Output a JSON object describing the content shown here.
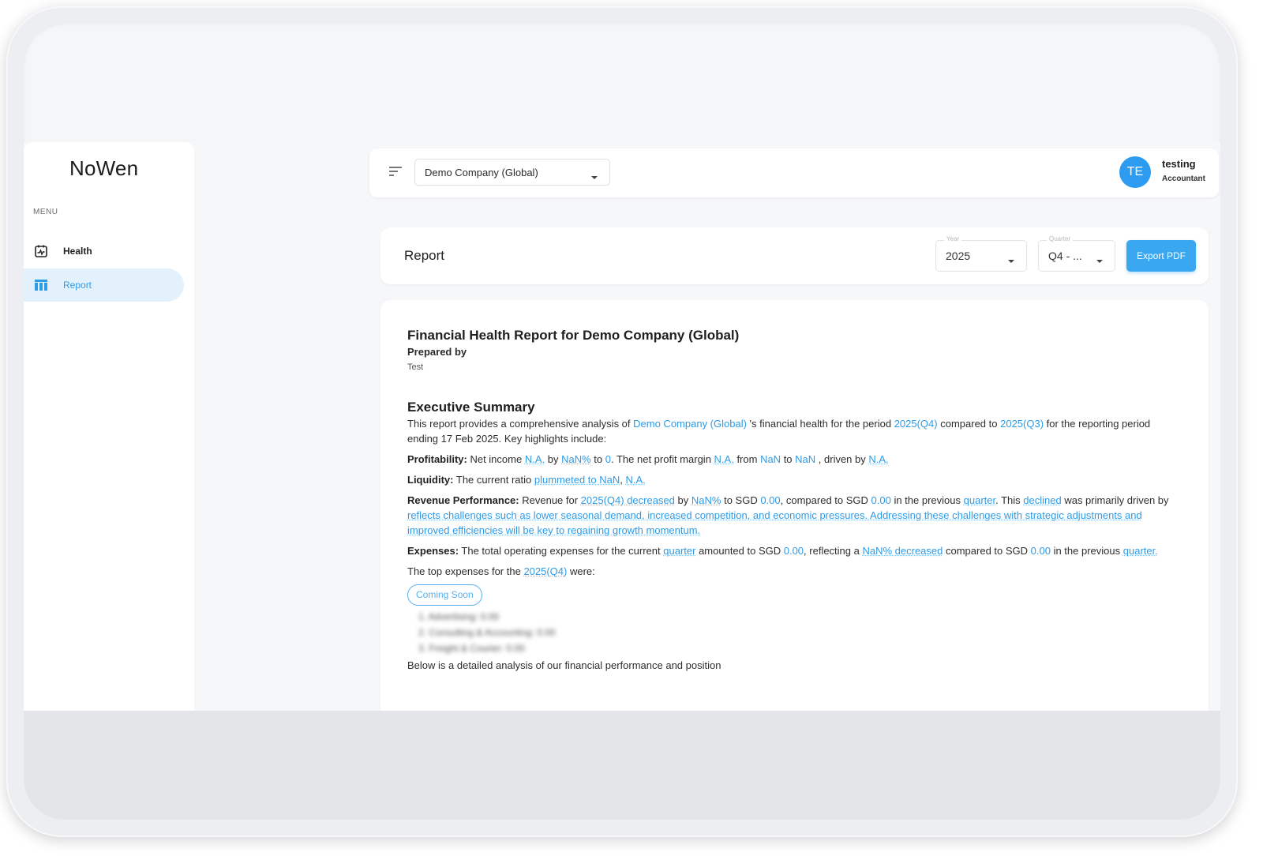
{
  "app": {
    "name": "NoWen"
  },
  "sidebar": {
    "menu_label": "MENU",
    "items": [
      {
        "label": "Health",
        "icon": "health-chart-icon",
        "active": false
      },
      {
        "label": "Report",
        "icon": "report-table-icon",
        "active": true
      }
    ]
  },
  "topbar": {
    "company": "Demo Company (Global)",
    "user": {
      "initials": "TE",
      "name": "testing",
      "role": "Accountant"
    }
  },
  "report_header": {
    "title": "Report",
    "year": {
      "legend": "Year",
      "value": "2025"
    },
    "quarter": {
      "legend": "Quarter",
      "value": "Q4 - ..."
    },
    "export_label": "Export PDF"
  },
  "report": {
    "title": "Financial Health Report for Demo Company (Global)",
    "prepared_by_label": "Prepared by",
    "prepared_by": "Test",
    "exec_summary_title": "Executive Summary",
    "intro": {
      "t1": "This report provides a comprehensive analysis of ",
      "company": "Demo Company (Global)",
      "t2": " 's financial health for the period ",
      "period": "2025(Q4)",
      "t3": " compared to ",
      "prev_period": "2025(Q3)",
      "t4": " for the reporting period ending 17 Feb 2025. Key highlights include:"
    },
    "profitability": {
      "label": "Profitability:",
      "t1": " Net income ",
      "v1": "N.A.",
      "t2": " by ",
      "v2": "NaN%",
      "t3": " to ",
      "v3": "0",
      "t4": ". The net profit margin ",
      "v4": "N.A.",
      "t5": " from ",
      "v5": "NaN",
      "t6": " to ",
      "v6": "NaN",
      "t7": " , driven by ",
      "v7": "N.A."
    },
    "liquidity": {
      "label": "Liquidity:",
      "t1": " The current ratio ",
      "v1": "plummeted to NaN",
      "t2": ", ",
      "v2": "N.A."
    },
    "revenue": {
      "label": "Revenue Performance:",
      "t1": " Revenue for ",
      "v1": "2025(Q4) decreased",
      "t2": " by ",
      "v2": "NaN%",
      "t3": " to SGD ",
      "v3": "0.00",
      "t4": ", compared to SGD ",
      "v4": "0.00",
      "t5": " in the previous ",
      "v5": "quarter",
      "t6": ". This ",
      "v6": "declined",
      "t7": " was primarily driven by ",
      "v7": "reflects challenges such as lower seasonal demand, increased competition, and economic pressures. Addressing these challenges with strategic adjustments and improved efficiencies will be key to regaining growth momentum."
    },
    "expenses": {
      "label": "Expenses:",
      "t1": " The total operating expenses for the current ",
      "v1": "quarter",
      "t2": " amounted to SGD ",
      "v2": "0.00",
      "t3": ", reflecting a ",
      "v3": "NaN% decreased",
      "t4": " compared to SGD ",
      "v4": "0.00",
      "t5": " in the previous ",
      "v5": "quarter."
    },
    "top_expenses": {
      "t1": "The top expenses for the ",
      "period": "2025(Q4)",
      "t2": " were:",
      "badge": "Coming Soon",
      "items": [
        "1. Advertising: 0.00",
        "2. Consulting & Accounting: 0.00",
        "3. Freight & Courier: 0.00"
      ]
    },
    "closing": "Below is a detailed analysis of our financial performance and position"
  }
}
